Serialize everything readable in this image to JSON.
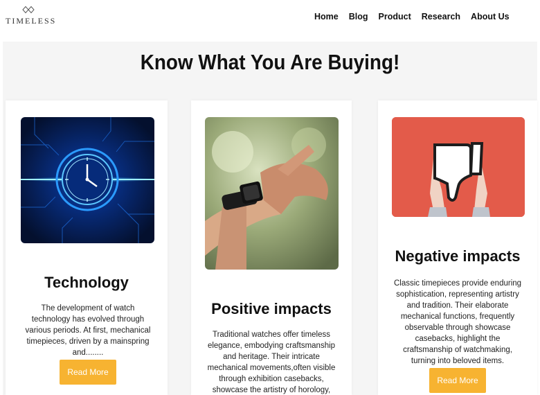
{
  "brand": {
    "name": "TIMELESS",
    "icon": "diamond-logo-icon"
  },
  "nav": {
    "items": [
      "Home",
      "Blog",
      "Product",
      "Research",
      "About Us"
    ]
  },
  "hero": {
    "title": "Know What You Are Buying!"
  },
  "cards": [
    {
      "title": "Technology",
      "image": "watch-technology-image",
      "text": "The development of watch technology has evolved through various periods. At first, mechanical timepieces, driven by a mainspring and........",
      "button": "Read More"
    },
    {
      "title": "Positive impacts",
      "image": "wrist-watch-photo",
      "text": "Traditional watches offer timeless elegance, embodying craftsmanship and heritage. Their intricate mechanical movements,often visible through exhibition casebacks, showcase the artistry of horology, becoming cherished",
      "button": "Read More"
    },
    {
      "title": "Negative impacts",
      "image": "thumbs-down-image",
      "text": "Classic timepieces provide enduring sophistication, representing artistry and tradition. Their elaborate mechanical functions, frequently observable through showcase casebacks, highlight the craftsmanship of watchmaking, turning into beloved items.",
      "button": "Read More"
    }
  ],
  "colors": {
    "accent": "#f7b331",
    "background": "#f5f5f5",
    "card": "#ffffff",
    "negative_bg": "#e35b4a"
  }
}
